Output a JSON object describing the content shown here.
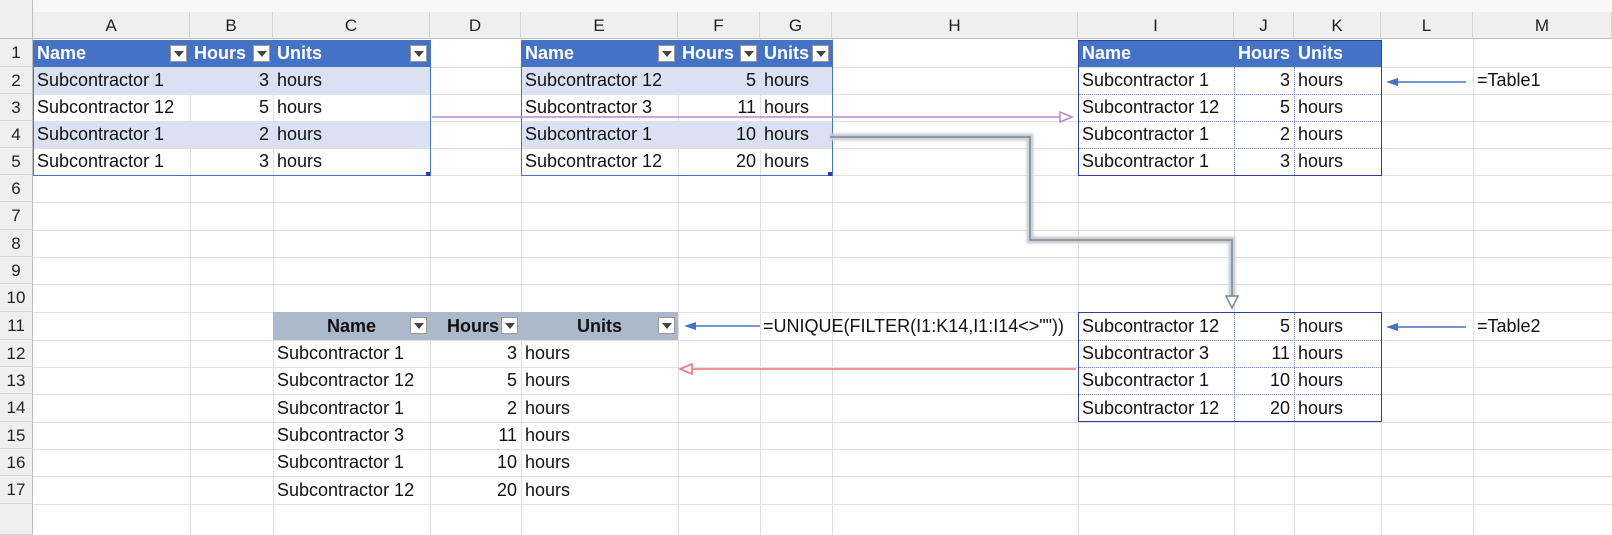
{
  "columns": [
    "A",
    "B",
    "C",
    "D",
    "E",
    "F",
    "G",
    "H",
    "I",
    "J",
    "K",
    "L",
    "M"
  ],
  "rows": [
    "1",
    "2",
    "3",
    "4",
    "5",
    "6",
    "7",
    "8",
    "9",
    "10",
    "11",
    "12",
    "13",
    "14",
    "15",
    "16",
    "17"
  ],
  "table1": {
    "headers": [
      "Name",
      "Hours",
      "Units"
    ],
    "rows": [
      [
        "Subcontractor 1",
        "3",
        "hours"
      ],
      [
        "Subcontractor 12",
        "5",
        "hours"
      ],
      [
        "Subcontractor 1",
        "2",
        "hours"
      ],
      [
        "Subcontractor 1",
        "3",
        "hours"
      ]
    ]
  },
  "table2": {
    "headers": [
      "Name",
      "Hours",
      "Units"
    ],
    "rows": [
      [
        "Subcontractor 12",
        "5",
        "hours"
      ],
      [
        "Subcontractor 3",
        "11",
        "hours"
      ],
      [
        "Subcontractor 1",
        "10",
        "hours"
      ],
      [
        "Subcontractor 12",
        "20",
        "hours"
      ]
    ]
  },
  "spill1": {
    "headers": [
      "Name",
      "Hours",
      "Units"
    ],
    "rows": [
      [
        "Subcontractor 1",
        "3",
        "hours"
      ],
      [
        "Subcontractor 12",
        "5",
        "hours"
      ],
      [
        "Subcontractor 1",
        "2",
        "hours"
      ],
      [
        "Subcontractor 1",
        "3",
        "hours"
      ]
    ],
    "note": "=Table1"
  },
  "spill2": {
    "rows": [
      [
        "Subcontractor 12",
        "5",
        "hours"
      ],
      [
        "Subcontractor 3",
        "11",
        "hours"
      ],
      [
        "Subcontractor 1",
        "10",
        "hours"
      ],
      [
        "Subcontractor 12",
        "20",
        "hours"
      ]
    ],
    "note": "=Table2"
  },
  "result": {
    "headers": [
      "Name",
      "Hours",
      "Units"
    ],
    "formula": "=UNIQUE(FILTER(I1:K14,I1:I14<>\"\"))",
    "rows": [
      [
        "Subcontractor 1",
        "3",
        "hours"
      ],
      [
        "Subcontractor 12",
        "5",
        "hours"
      ],
      [
        "Subcontractor 1",
        "2",
        "hours"
      ],
      [
        "Subcontractor 3",
        "11",
        "hours"
      ],
      [
        "Subcontractor 1",
        "10",
        "hours"
      ],
      [
        "Subcontractor 12",
        "20",
        "hours"
      ]
    ]
  },
  "colors": {
    "table_header": "#4472c4",
    "table_band": "#d9e1f2",
    "result_header": "#acb9ca",
    "arrow_blue": "#4472c4",
    "arrow_purple": "#c9a6e0",
    "arrow_gray": "#8c95a3",
    "arrow_red": "#f08080"
  }
}
